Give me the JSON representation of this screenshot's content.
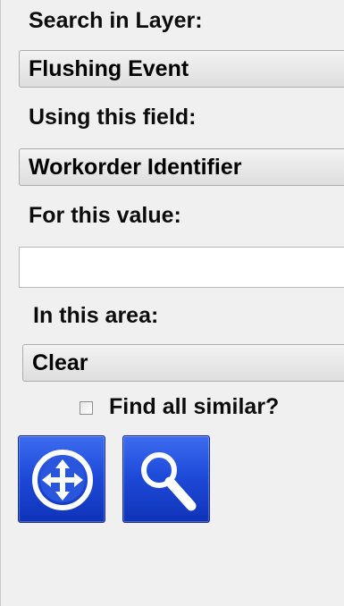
{
  "search_panel": {
    "layer_label": "Search in Layer:",
    "layer_value": "Flushing Event",
    "field_label": "Using this field:",
    "field_value": "Workorder Identifier",
    "value_label": "For this value:",
    "value_text": "",
    "area_label": "In this area:",
    "area_value": "Clear",
    "find_similar_label": "Find all similar?",
    "find_similar_checked": false
  },
  "buttons": {
    "pan_icon": "pan-arrows-icon",
    "search_icon": "magnifier-icon"
  },
  "colors": {
    "button_blue": "#1f4bd9",
    "panel_bg": "#f0f0f0"
  }
}
